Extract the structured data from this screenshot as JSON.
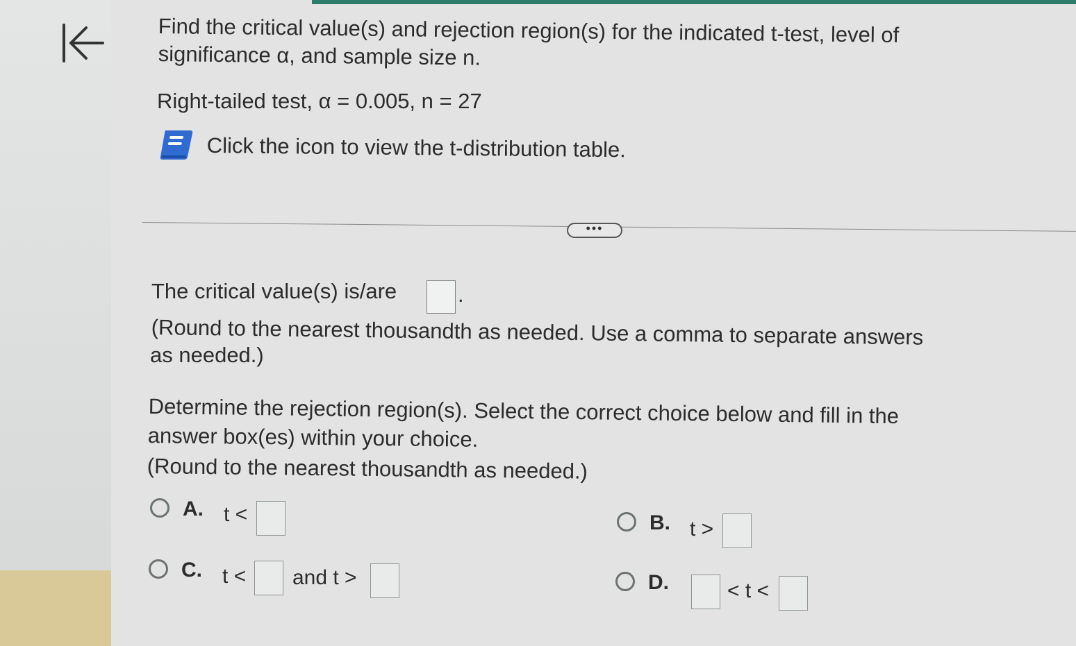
{
  "question": {
    "prompt_line1": "Find the critical value(s) and rejection region(s) for the indicated t-test, level of",
    "prompt_line2": "significance α, and sample size n.",
    "given": "Right-tailed test, α = 0.005, n = 27",
    "table_hint": "Click the icon to view the t-distribution table."
  },
  "more_button_label": "•••",
  "critical_value": {
    "prompt": "The critical value(s) is/are",
    "suffix": ".",
    "value": "",
    "hint_line1": "(Round to the nearest thousandth as needed. Use a comma to separate answers",
    "hint_line2": "as needed.)"
  },
  "rejection": {
    "line1": "Determine the rejection region(s). Select the correct choice below and fill in the",
    "line2": "answer box(es) within your choice.",
    "line3": "(Round to the nearest thousandth as needed.)"
  },
  "choices": [
    {
      "letter": "A.",
      "left": "t <",
      "right": ""
    },
    {
      "letter": "B.",
      "left": "t >",
      "right": ""
    },
    {
      "letter": "C.",
      "left": "t <",
      "middle": "and t >"
    },
    {
      "letter": "D.",
      "middle": "< t <"
    }
  ],
  "colors": {
    "accent": "#2e7d6a",
    "book_icon": "#2f6bd1",
    "background": "#e2e3e2"
  },
  "icons": [
    "back-to-start-icon",
    "book-icon"
  ]
}
